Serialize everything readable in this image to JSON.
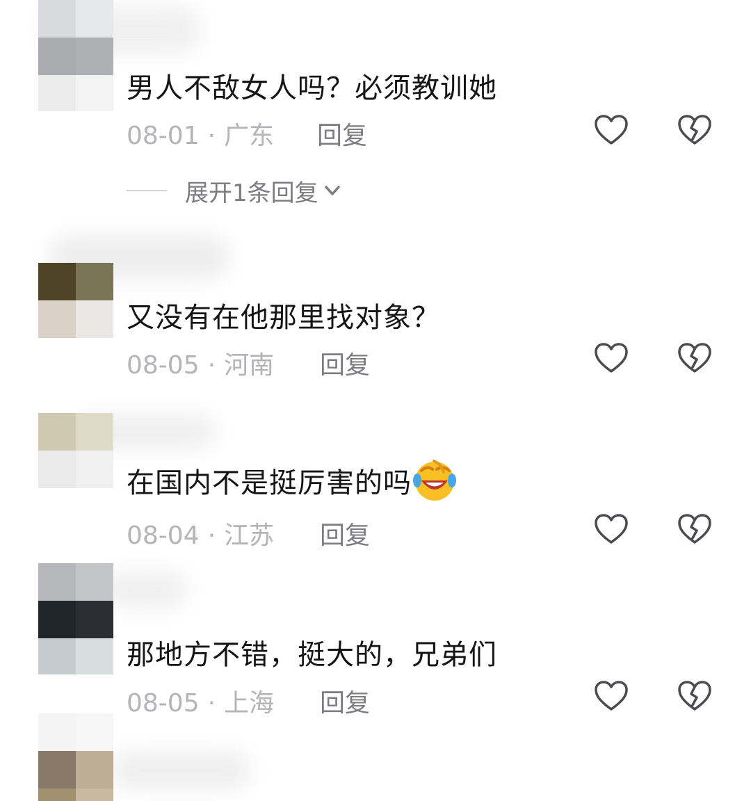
{
  "comments": [
    {
      "text": "男人不敌女人吗？必须教训她",
      "date": "08-01",
      "location": "广东",
      "reply_label": "回复",
      "expand_label": "展开1条回复"
    },
    {
      "text": "又没有在他那里找对象？",
      "date": "08-05",
      "location": "河南",
      "reply_label": "回复"
    },
    {
      "text": "在国内不是挺厉害的吗",
      "emoji": "laughing-crying-emoji",
      "date": "08-04",
      "location": "江苏",
      "reply_label": "回复"
    },
    {
      "text": "那地方不错，挺大的，兄弟们",
      "date": "08-05",
      "location": "上海",
      "reply_label": "回复"
    }
  ],
  "meta_separator": "·",
  "icons": {
    "like": "heart-outline-icon",
    "dislike": "broken-heart-icon",
    "expand": "chevron-down-icon"
  },
  "colors": {
    "text": "#151515",
    "meta": "#b3b3b8",
    "reply": "#7c7c82",
    "icon": "#4a4a50"
  }
}
